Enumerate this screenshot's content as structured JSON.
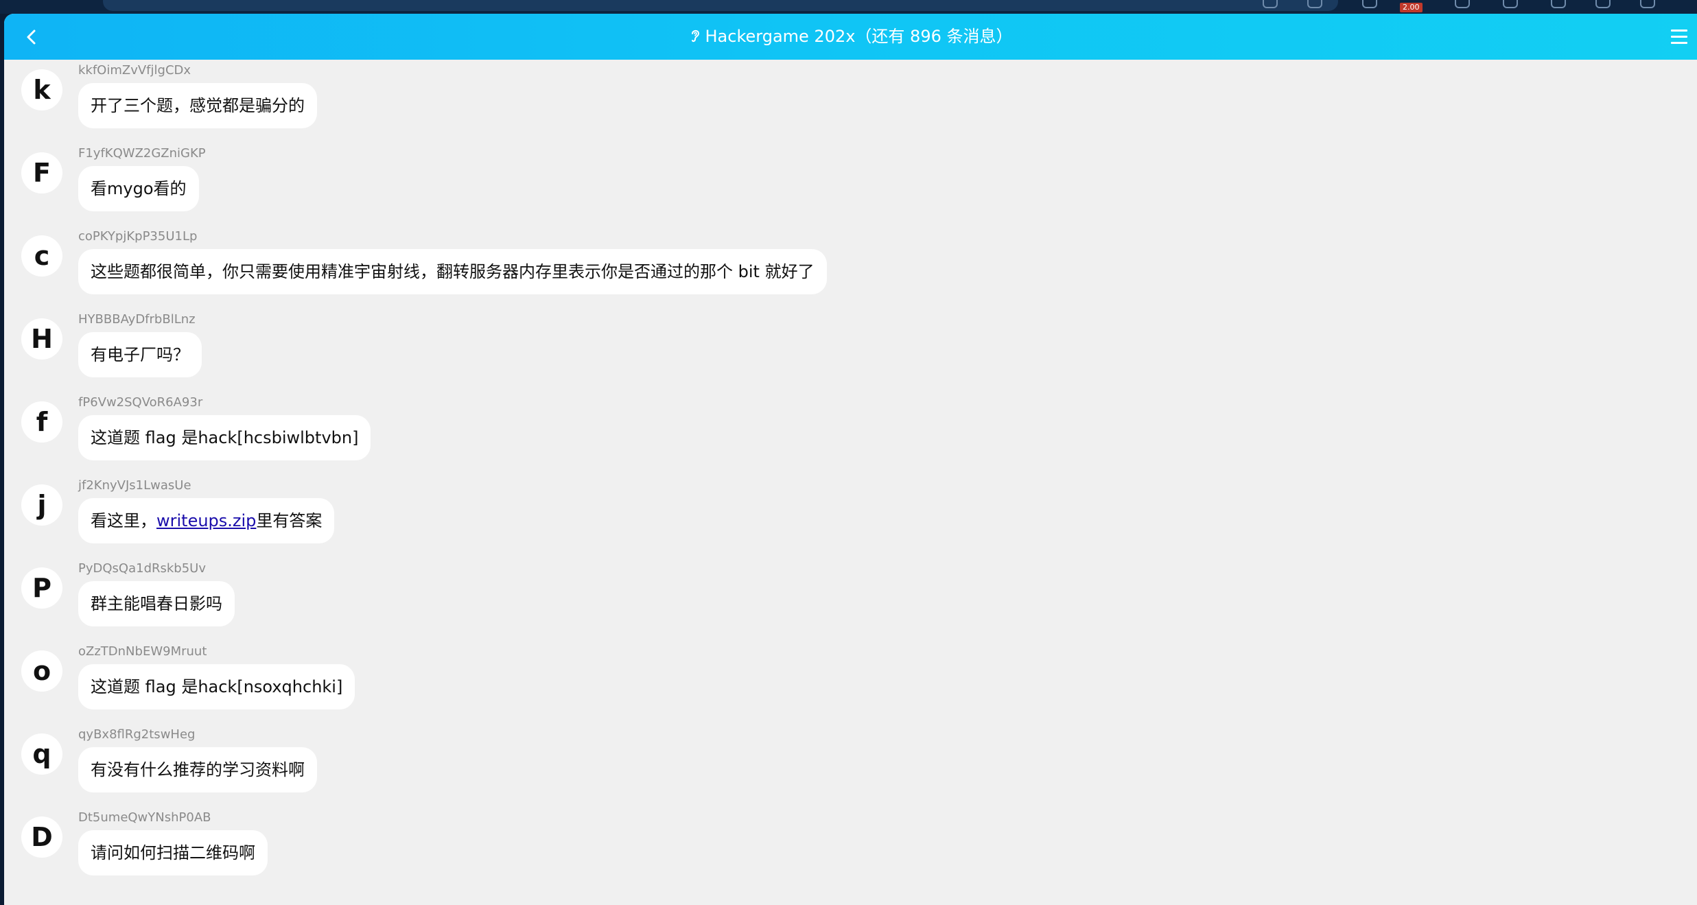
{
  "browser": {
    "extension_badge": "2.00"
  },
  "header": {
    "title": "Hackergame 202x（还有 896 条消息）",
    "accent_color": "#10c3f5",
    "back_icon": "chevron-left-icon",
    "menu_icon": "hamburger-menu-icon",
    "title_icon": "ear-icon"
  },
  "messages": [
    {
      "avatar": "k",
      "user": "kkfOimZvVfjlgCDx",
      "text": "开了三个题，感觉都是骗分的"
    },
    {
      "avatar": "F",
      "user": "F1yfKQWZ2GZniGKP",
      "text": "看mygo看的"
    },
    {
      "avatar": "c",
      "user": "coPKYpjKpP35U1Lp",
      "text": "这些题都很简单，你只需要使用精准宇宙射线，翻转服务器内存里表示你是否通过的那个 bit 就好了"
    },
    {
      "avatar": "H",
      "user": "HYBBBAyDfrbBlLnz",
      "text": "有电子厂吗？"
    },
    {
      "avatar": "f",
      "user": "fP6Vw2SQVoR6A93r",
      "text": "这道题 flag 是hack[hcsbiwlbtvbn]"
    },
    {
      "avatar": "j",
      "user": "jf2KnyVJs1LwasUe",
      "text_before": "看这里，",
      "link": "writeups.zip",
      "text_after": "里有答案"
    },
    {
      "avatar": "P",
      "user": "PyDQsQa1dRskb5Uv",
      "text": "群主能唱春日影吗"
    },
    {
      "avatar": "o",
      "user": "oZzTDnNbEW9Mruut",
      "text": "这道题 flag 是hack[nsoxqhchki]"
    },
    {
      "avatar": "q",
      "user": "qyBx8flRg2tswHeg",
      "text": "有没有什么推荐的学习资料啊"
    },
    {
      "avatar": "D",
      "user": "Dt5umeQwYNshP0AB",
      "text": "请问如何扫描二维码啊"
    }
  ]
}
